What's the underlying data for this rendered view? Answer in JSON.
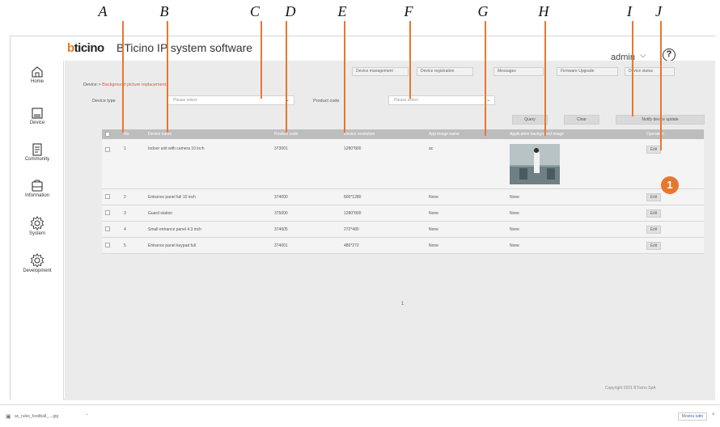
{
  "annotations": {
    "letters": [
      "A",
      "B",
      "C",
      "D",
      "E",
      "F",
      "G",
      "H",
      "I",
      "J"
    ],
    "callout": "1",
    "accent_color": "#e8772e"
  },
  "app": {
    "logo": "bticino",
    "title": "BTicino IP system software",
    "user": "admin",
    "help": "?"
  },
  "sidebar": {
    "items": [
      {
        "label": "Home",
        "icon": "home-icon"
      },
      {
        "label": "Device",
        "icon": "device-icon"
      },
      {
        "label": "Community",
        "icon": "community-icon"
      },
      {
        "label": "Information",
        "icon": "information-icon"
      },
      {
        "label": "System",
        "icon": "system-gear-icon"
      },
      {
        "label": "Development",
        "icon": "development-gear-icon"
      }
    ]
  },
  "topnav": {
    "buttons": [
      "Device management",
      "Device registration",
      "Messages",
      "Firmware Upgrade",
      "Device status"
    ]
  },
  "breadcrumb": {
    "root": "Device",
    "current": "Background picture replacement"
  },
  "filters": {
    "device_type_label": "Device type",
    "device_type_placeholder": "Please select",
    "product_code_label": "Product code",
    "product_code_placeholder": "Please select"
  },
  "actions": {
    "query": "Query",
    "clear": "Clear",
    "notify": "Notify device update"
  },
  "table": {
    "headers": [
      "No.",
      "Device name",
      "Product code",
      "Device resolution",
      "App image name",
      "Application background image",
      "Operation"
    ],
    "rows": [
      {
        "no": "1",
        "name": "Indoor unit with camera 10 inch",
        "code": "373001",
        "resolution": "1280*800",
        "image_name": "ac",
        "image": "thumbnail",
        "op": "Edit"
      },
      {
        "no": "2",
        "name": "Entrance panel full 10 inch",
        "code": "374000",
        "resolution": "800*1280",
        "image_name": "None",
        "image": "None",
        "op": "Edit"
      },
      {
        "no": "3",
        "name": "Guard station",
        "code": "375000",
        "resolution": "1280*800",
        "image_name": "None",
        "image": "None",
        "op": "Edit"
      },
      {
        "no": "4",
        "name": "Small entrance panel 4.3 inch",
        "code": "374005",
        "resolution": "272*480",
        "image_name": "None",
        "image": "None",
        "op": "Edit"
      },
      {
        "no": "5",
        "name": "Entrance panel keypad full",
        "code": "374001",
        "resolution": "480*272",
        "image_name": "None",
        "image": "None",
        "op": "Edit"
      }
    ]
  },
  "pager": "1",
  "copyright": "Copyright 2021 BTicino SpA",
  "download_bar": {
    "file": "ac_rules_foodball_....jpg",
    "show_all": "Mostra tutto",
    "close": "×"
  }
}
